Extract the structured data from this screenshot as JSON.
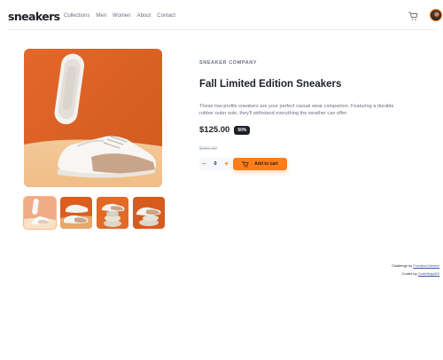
{
  "header": {
    "logo": "sneakers",
    "nav": [
      "Collections",
      "Men",
      "Women",
      "About",
      "Contact"
    ],
    "cart_icon": "cart-icon",
    "avatar_icon": "user-avatar"
  },
  "product": {
    "company": "SNEAKER COMPANY",
    "title": "Fall Limited Edition Sneakers",
    "description": "These low-profile sneakers are your perfect casual wear companion. Featuring a durable rubber outer sole, they'll withstand everything the weather can offer.",
    "price": "$125.00",
    "discount": "50%",
    "original_price": "$250.00",
    "quantity": "0",
    "minus": "−",
    "plus": "+",
    "add_to_cart": "Add to cart"
  },
  "gallery": {
    "thumbnail_count": 4,
    "active_thumbnail": 1
  },
  "attribution": {
    "line1_prefix": "Challenge by ",
    "line1_link": "Frontend Mentor",
    "line2_prefix": "Coded by ",
    "line2_link": "CodeNinjaDS"
  },
  "colors": {
    "accent": "#ff7d1a",
    "dark": "#1d2026",
    "muted": "#69707d",
    "light_bg": "#f7f8fd"
  }
}
